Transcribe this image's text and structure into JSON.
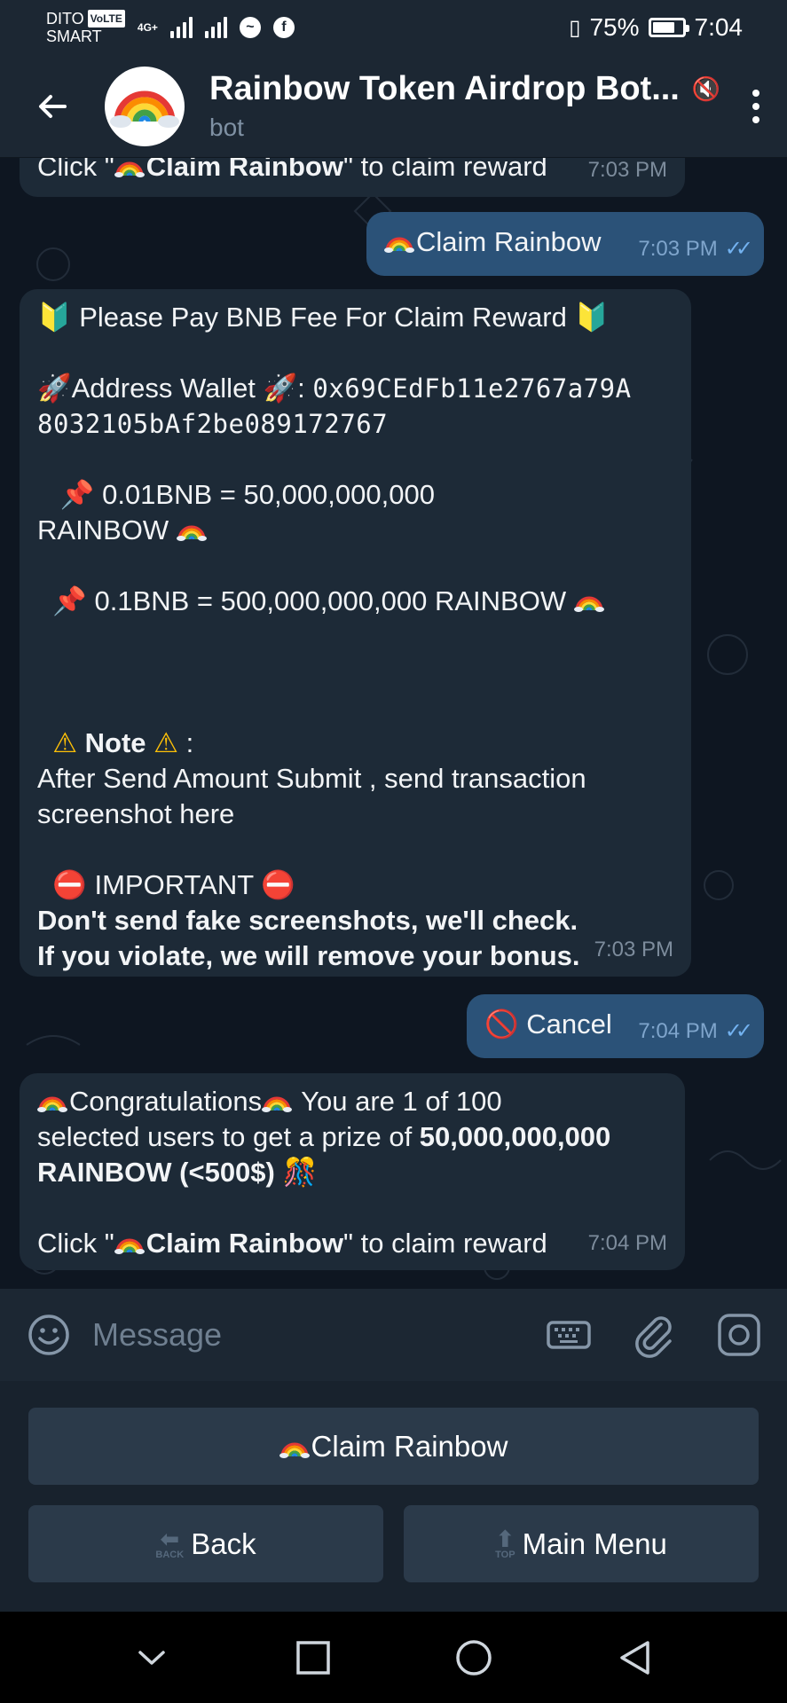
{
  "status_bar": {
    "carrier_top": "DITO",
    "volte": "VoLTE",
    "carrier_bottom": "SMART",
    "network": "4G+",
    "battery": "75%",
    "time": "7:04"
  },
  "header": {
    "title": "Rainbow Token Airdrop Bot...",
    "subtitle": "bot"
  },
  "messages": {
    "m1": {
      "text_pre": "Click \"",
      "bold": "Claim Rainbow",
      "text_post": "\" to claim reward",
      "time": "7:03 PM"
    },
    "m2": {
      "text": "Claim Rainbow",
      "time": "7:03 PM"
    },
    "m3": {
      "title": "Please Pay BNB Fee For Claim Reward",
      "address_label": "Address Wallet",
      "address_line1": "0x69CEdFb11e2767a79A",
      "address_line2": "8032105bAf2be089172767",
      "rate1_line1": "0.01BNB = 50,000,000,000",
      "rate1_line2": "RAINBOW",
      "rate2": "0.1BNB = 500,000,000,000 RAINBOW",
      "note_label": "Note",
      "note_line1": "After Send Amount Submit , send transaction",
      "note_line2": "screenshot here",
      "important_label": "IMPORTANT",
      "important_line1": "Don't send fake screenshots, we'll check.",
      "important_line2": "If you violate, we will remove your bonus.",
      "time": "7:03 PM"
    },
    "m4": {
      "text": "Cancel",
      "time": "7:04 PM"
    },
    "m5": {
      "line1_a": "Congratulations",
      "line1_b": " You are 1 of 100",
      "line2_a": "selected users to get a prize of ",
      "line2_b": "50,000,000,000",
      "line3": "RAINBOW (<500$)",
      "line4_pre": "Click \"",
      "line4_bold": "Claim Rainbow",
      "line4_post": "\" to claim reward",
      "time": "7:04 PM"
    }
  },
  "input": {
    "placeholder": "Message"
  },
  "keyboard": {
    "claim": "Claim Rainbow",
    "back": "Back",
    "back_mini": "BACK",
    "main_menu": "Main Menu",
    "top_mini": "TOP"
  },
  "colors": {
    "background": "#0e1621",
    "bar": "#1c2733",
    "incoming_bubble": "#1d2a37",
    "outgoing_bubble": "#2b5278",
    "accent_check": "#73b2f0"
  },
  "icons": {
    "back": "arrow-left-icon",
    "menu": "more-vertical-icon",
    "emoji": "smile-icon",
    "keyboard": "keyboard-icon",
    "attach": "paperclip-icon",
    "camera": "camera-icon"
  }
}
